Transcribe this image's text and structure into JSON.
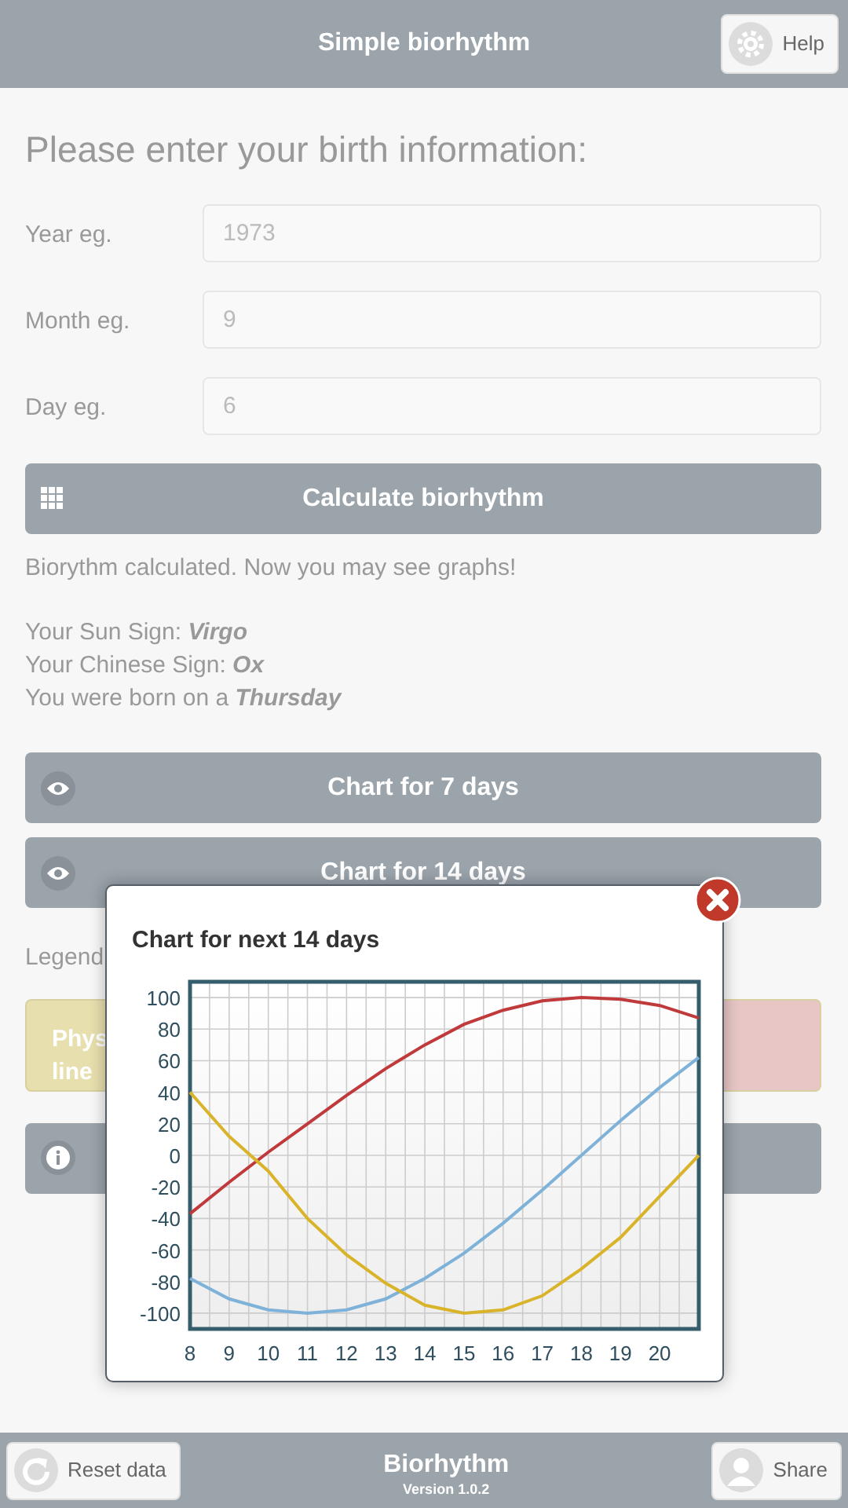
{
  "header": {
    "title": "Simple biorhythm",
    "help_button": "Help"
  },
  "form": {
    "heading": "Please enter your birth information:",
    "fields": [
      {
        "label": "Year eg.",
        "placeholder": "1973"
      },
      {
        "label": "Month eg.",
        "placeholder": "9"
      },
      {
        "label": "Day eg.",
        "placeholder": "6"
      }
    ]
  },
  "calculate_button": "Calculate biorhythm",
  "result": {
    "message": "Biorythm calculated. Now you may see graphs!",
    "lines": [
      "Your Sun Sign: **Virgo**",
      "Your Chinese Sign: **Ox**",
      "You were born on a **Thursday**"
    ]
  },
  "chart_buttons": [
    "Chart for 7 days",
    "Chart for 14 days"
  ],
  "legend": {
    "label": "Legend",
    "items": [
      {
        "lines": [
          "Phys",
          "line"
        ],
        "color": "#e8dfae"
      },
      {
        "color": "#e8c6c6"
      }
    ]
  },
  "popup": {
    "title": "Chart for next 14 days",
    "chart_data": {
      "type": "line",
      "grid": true,
      "x": [
        8,
        9,
        10,
        11,
        12,
        13,
        14,
        15,
        16,
        17,
        18,
        19,
        20,
        21
      ],
      "xlim": [
        8,
        21
      ],
      "ylim": [
        -110,
        110
      ],
      "xticks": [
        8,
        9,
        10,
        11,
        12,
        13,
        14,
        15,
        16,
        17,
        18,
        19,
        20
      ],
      "yticks": [
        -100,
        -80,
        -60,
        -40,
        -20,
        0,
        20,
        40,
        60,
        80,
        100
      ],
      "series": [
        {
          "color": "#c0393b",
          "values": [
            -37,
            -17,
            2,
            20,
            38,
            55,
            70,
            83,
            92,
            98,
            100,
            99,
            95,
            87
          ]
        },
        {
          "color": "#7fb2d9",
          "values": [
            -78,
            -91,
            -98,
            -100,
            -98,
            -91,
            -78,
            -62,
            -43,
            -22,
            0,
            22,
            43,
            62
          ]
        },
        {
          "color": "#d9b42a",
          "values": [
            40,
            12,
            -10,
            -40,
            -63,
            -81,
            -95,
            -100,
            -98,
            -89,
            -72,
            -52,
            -26,
            0
          ]
        }
      ]
    }
  },
  "footer": {
    "reset_button": "Reset data",
    "title": "Biorhythm",
    "version": "Version 1.0.2",
    "share_button": "Share"
  }
}
